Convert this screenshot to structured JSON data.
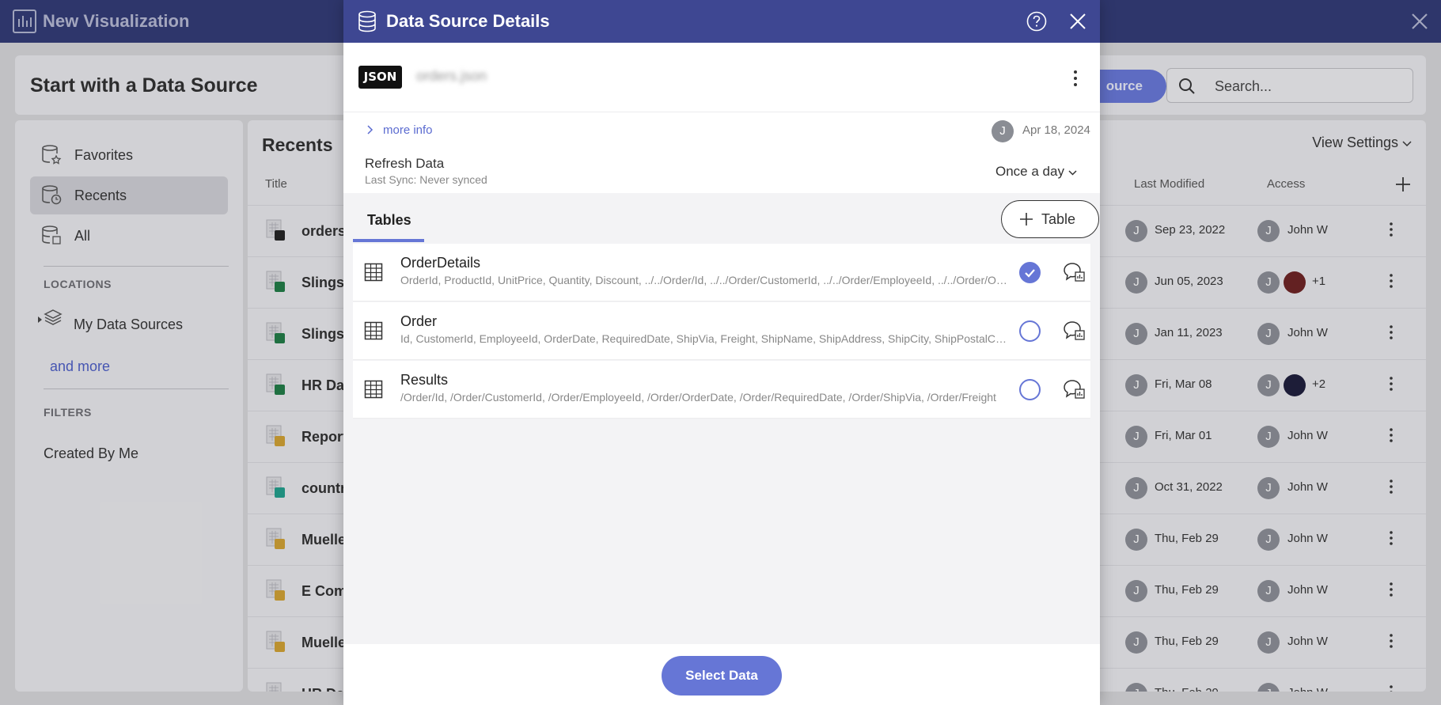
{
  "topbar": {
    "title": "New Visualization",
    "icon": "bar-chart-icon"
  },
  "header": {
    "title": "Start with a Data Source",
    "add_button_label": "ource",
    "search_placeholder": "Search..."
  },
  "sidebar": {
    "items": [
      {
        "label": "Favorites",
        "icon": "favorites-db-icon"
      },
      {
        "label": "Recents",
        "icon": "recents-db-icon"
      },
      {
        "label": "All",
        "icon": "all-db-icon"
      }
    ],
    "locations_heading": "LOCATIONS",
    "my_data_sources": "My Data Sources",
    "and_more": "and more",
    "filters_heading": "FILTERS",
    "created_by_me": "Created By Me"
  },
  "main": {
    "title": "Recents",
    "view_settings": "View Settings",
    "columns": {
      "title": "Title",
      "last_modified": "Last Modified",
      "access": "Access"
    },
    "rows": [
      {
        "name": "orders",
        "date": "Sep 23, 2022",
        "access": "John W",
        "badge": "JSON"
      },
      {
        "name": "Slingsh",
        "date": "Jun 05, 2023",
        "access": "+1",
        "badge": "X"
      },
      {
        "name": "Slingsh",
        "date": "Jan 11, 2023",
        "access": "John W",
        "badge": "X"
      },
      {
        "name": "HR Dat",
        "date": "Fri, Mar 08",
        "access": "+2",
        "badge": "X"
      },
      {
        "name": "Report",
        "date": "Fri, Mar 01",
        "access": "John W",
        "badge": ""
      },
      {
        "name": "countr",
        "date": "Oct 31, 2022",
        "access": "John W",
        "badge": "CSV"
      },
      {
        "name": "Muelle",
        "date": "Thu, Feb 29",
        "access": "John W",
        "badge": ""
      },
      {
        "name": "E Comp",
        "date": "Thu, Feb 29",
        "access": "John W",
        "badge": ""
      },
      {
        "name": "Muelle",
        "date": "Thu, Feb 29",
        "access": "John W",
        "badge": ""
      },
      {
        "name": "HR Dat",
        "date": "Thu, Feb 29",
        "access": "John W",
        "badge": ""
      }
    ],
    "avatar_initial": "J"
  },
  "modal": {
    "title": "Data Source Details",
    "source_type_badge": "JSON",
    "source_name": "orders.json",
    "more_info": "more info",
    "avatar_initial": "J",
    "date": "Apr 18, 2024",
    "refresh_title": "Refresh Data",
    "refresh_sub": "Last Sync: Never synced",
    "refresh_frequency": "Once a day",
    "tab_tables": "Tables",
    "add_table_label": "Table",
    "tables": [
      {
        "name": "OrderDetails",
        "columns": "OrderId, ProductId, UnitPrice, Quantity, Discount, ../../Order/Id, ../../Order/CustomerId, ../../Order/EmployeeId, ../../Order/OrderDate",
        "selected": true
      },
      {
        "name": "Order",
        "columns": "Id, CustomerId, EmployeeId, OrderDate, RequiredDate, ShipVia, Freight, ShipName, ShipAddress, ShipCity, ShipPostalCode",
        "selected": false
      },
      {
        "name": "Results",
        "columns": "/Order/Id, /Order/CustomerId, /Order/EmployeeId, /Order/OrderDate, /Order/RequiredDate, /Order/ShipVia, /Order/Freight",
        "selected": false
      }
    ],
    "select_button": "Select Data"
  },
  "colors": {
    "accent": "#6676d6",
    "header": "#3e4792",
    "topbar": "#2f3873"
  }
}
